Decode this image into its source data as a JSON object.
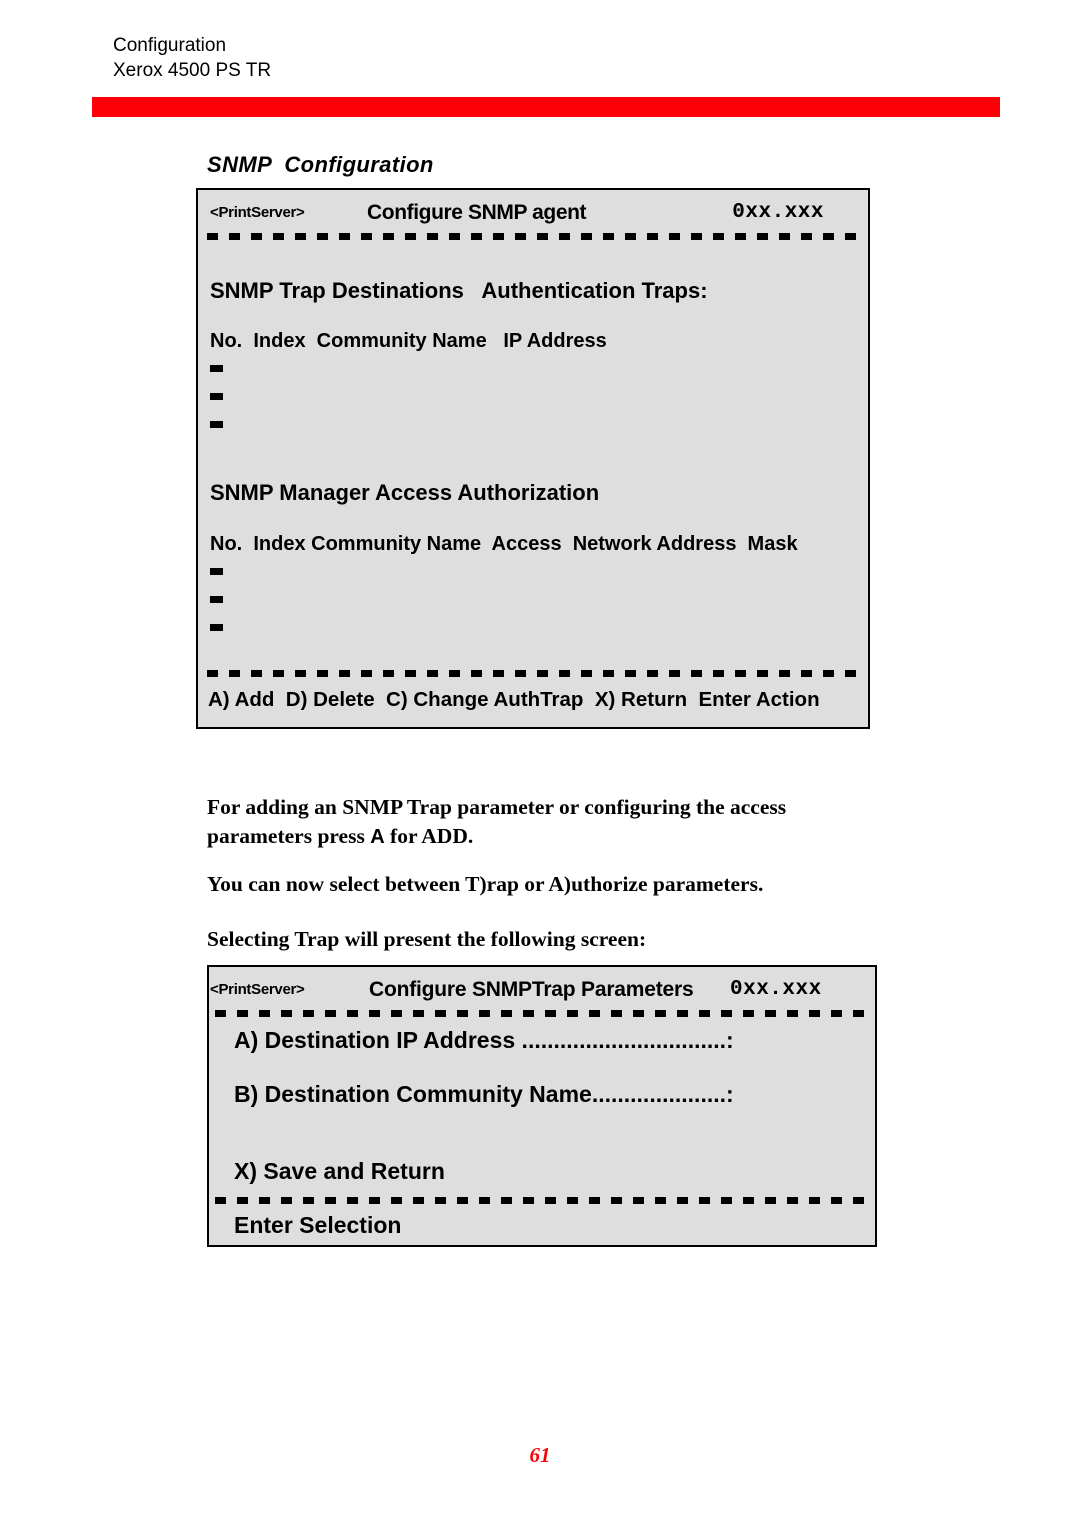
{
  "header": {
    "line1": "Configuration",
    "line2": "Xerox 4500 PS TR",
    "rule_color": "#fb0007"
  },
  "section": {
    "title": "SNMP  Configuration"
  },
  "panel_agent": {
    "tag": "<PrintServer>",
    "title": "Configure SNMP agent",
    "version": "0xx.xxx",
    "trap_destinations_heading": "SNMP Trap Destinations   Authentication Traps:",
    "trap_columns": "No.  Index  Community Name   IP Address",
    "trap_rows": [
      "-",
      "-",
      "-"
    ],
    "manager_heading": "SNMP Manager Access Authorization",
    "manager_columns": "No.  Index Community Name  Access  Network Address  Mask",
    "manager_rows": [
      "-",
      "-",
      "-"
    ],
    "actions": "A) Add  D) Delete  C) Change AuthTrap  X) Return  Enter Action"
  },
  "body": {
    "para1_a": "For adding an SNMP Trap parameter or configuring the access parameters press ",
    "para1_key": "A",
    "para1_b": " for ADD.",
    "para2": "You can now select between T)rap or A)uthorize parameters.",
    "para3": "Selecting Trap will present the following screen:"
  },
  "panel_trap": {
    "tag": "<PrintServer>",
    "title": "Configure SNMPTrap Parameters",
    "version": "0xx.xxx",
    "option_a": "A) Destination IP Address ................................:",
    "option_b": "B) Destination Community Name.....................:",
    "option_x": "X) Save and Return",
    "prompt": "Enter Selection"
  },
  "footer": {
    "page_number": "61"
  }
}
